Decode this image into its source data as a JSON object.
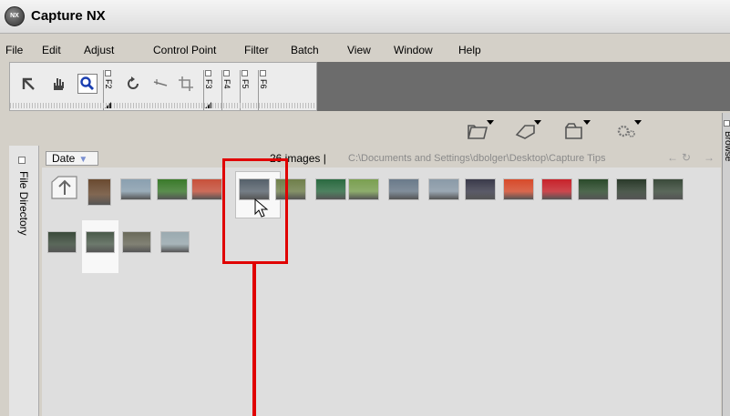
{
  "window": {
    "title": "Capture NX",
    "logo_text": "NX"
  },
  "menu": {
    "items": [
      "File",
      "Edit",
      "Adjust",
      "Control Point",
      "Filter",
      "Batch",
      "View",
      "Window",
      "Help"
    ]
  },
  "toolbar": {
    "tools": [
      "arrow-pointer-icon",
      "hand-icon",
      "zoom-icon",
      "rotate-icon",
      "straighten-icon",
      "crop-icon"
    ],
    "fkeys": [
      "F2",
      "F3",
      "F4",
      "F5",
      "F6"
    ]
  },
  "actions": {
    "icons": [
      "open-folder-icon",
      "tag-icon",
      "folder-save-icon",
      "gear-icon"
    ]
  },
  "sidebar": {
    "label": "File Directory"
  },
  "browser": {
    "sort_label": "Date",
    "image_count": "26 images |",
    "path": "C:\\Documents and Settings\\dbolger\\Desktop\\Capture Tips",
    "thumbnail_colors_row1": [
      "#6a4a30",
      "#8aa0b0",
      "#3a7a2a",
      "#c8503a",
      "#55606a",
      "#6f7f4a",
      "#2a6a40",
      "#7aa050",
      "#6a7a8a",
      "#8a9aa8",
      "#3a3a4a",
      "#d84a2a",
      "#c8222a",
      "#2a4a2a",
      "#2a3a2a",
      "#3a4a3a"
    ],
    "thumbnail_colors_row2": [
      "#3a4a3a",
      "#4a5a4a",
      "#6a6a5a",
      "#9aaab0"
    ]
  },
  "right_panel": {
    "label": "Browse"
  },
  "colors": {
    "highlight": "#e00000",
    "toolbar_dark": "#6c6c6c"
  }
}
